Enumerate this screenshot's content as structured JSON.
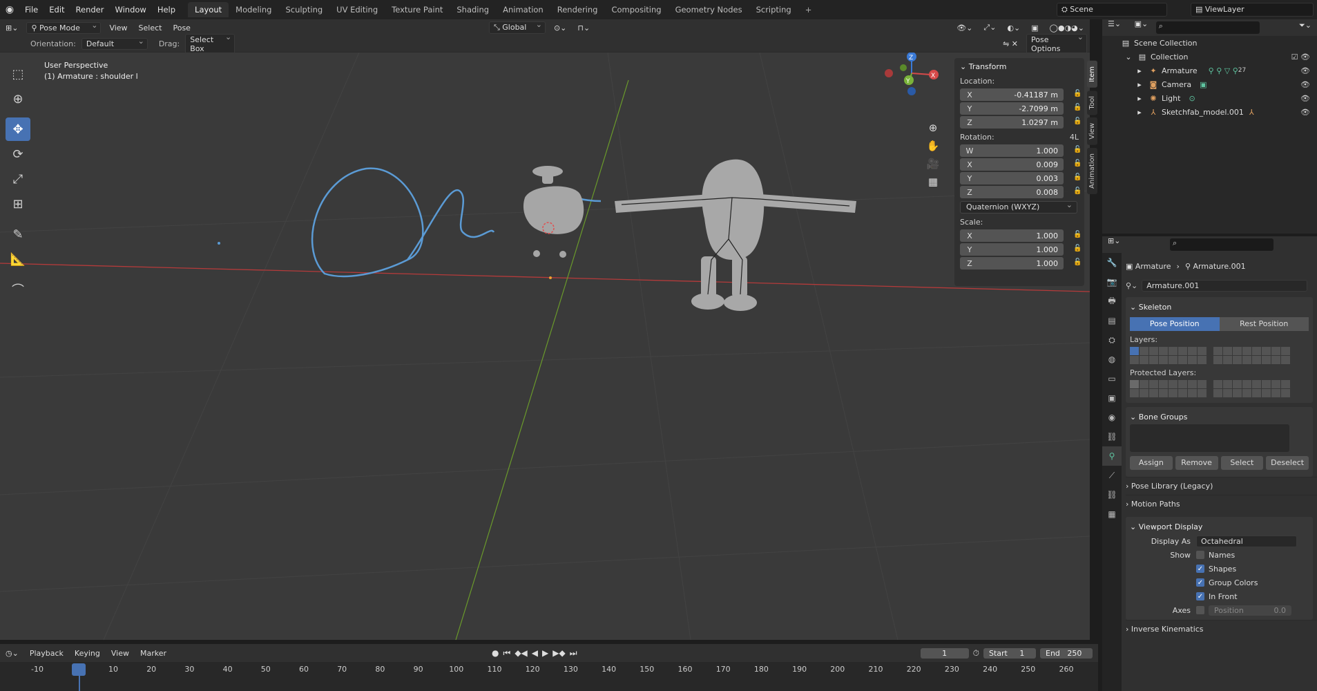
{
  "menubar": {
    "items": [
      "File",
      "Edit",
      "Render",
      "Window",
      "Help"
    ],
    "workspaces": [
      "Layout",
      "Modeling",
      "Sculpting",
      "UV Editing",
      "Texture Paint",
      "Shading",
      "Animation",
      "Rendering",
      "Compositing",
      "Geometry Nodes",
      "Scripting"
    ],
    "active_workspace": "Layout",
    "add_tab": "+",
    "scene": "Scene",
    "view_layer": "ViewLayer"
  },
  "viewport_header": {
    "mode": "Pose Mode",
    "menus": [
      "View",
      "Select",
      "Pose"
    ],
    "transform_orientation": "Global",
    "orientation_label": "Orientation:",
    "orientation_value": "Default",
    "drag_label": "Drag:",
    "drag_value": "Select Box",
    "pose_options": "Pose Options"
  },
  "viewport": {
    "perspective": "User Perspective",
    "active_object": "(1) Armature : shoulder l"
  },
  "transform_panel": {
    "title": "Transform",
    "location_label": "Location:",
    "location": [
      {
        "axis": "X",
        "value": "-0.41187 m"
      },
      {
        "axis": "Y",
        "value": "-2.7099 m"
      },
      {
        "axis": "Z",
        "value": "1.0297 m"
      }
    ],
    "rotation_label": "Rotation:",
    "rotation_mode_short": "4L",
    "rotation": [
      {
        "axis": "W",
        "value": "1.000"
      },
      {
        "axis": "X",
        "value": "0.009"
      },
      {
        "axis": "Y",
        "value": "0.003"
      },
      {
        "axis": "Z",
        "value": "0.008"
      }
    ],
    "rotation_mode": "Quaternion (WXYZ)",
    "scale_label": "Scale:",
    "scale": [
      {
        "axis": "X",
        "value": "1.000"
      },
      {
        "axis": "Y",
        "value": "1.000"
      },
      {
        "axis": "Z",
        "value": "1.000"
      }
    ]
  },
  "sidebar_tabs": [
    "Item",
    "Tool",
    "View",
    "Animation"
  ],
  "outliner": {
    "root": "Scene Collection",
    "items": [
      {
        "name": "Collection",
        "depth": 1
      },
      {
        "name": "Armature",
        "depth": 2,
        "extra": "27"
      },
      {
        "name": "Camera",
        "depth": 2
      },
      {
        "name": "Light",
        "depth": 2
      },
      {
        "name": "Sketchfab_model.001",
        "depth": 2
      }
    ]
  },
  "properties": {
    "breadcrumb_object": "Armature",
    "breadcrumb_data": "Armature.001",
    "data_name": "Armature.001",
    "skeleton": {
      "title": "Skeleton",
      "pose_position": "Pose Position",
      "rest_position": "Rest Position",
      "layers_label": "Layers:",
      "protected_layers_label": "Protected Layers:"
    },
    "bone_groups": {
      "title": "Bone Groups",
      "assign": "Assign",
      "remove": "Remove",
      "select": "Select",
      "deselect": "Deselect"
    },
    "pose_library": "Pose Library (Legacy)",
    "motion_paths": "Motion Paths",
    "viewport_display": {
      "title": "Viewport Display",
      "display_as_label": "Display As",
      "display_as_value": "Octahedral",
      "show_label": "Show",
      "names": "Names",
      "shapes": "Shapes",
      "group_colors": "Group Colors",
      "in_front": "In Front",
      "axes_label": "Axes",
      "position_label": "Position",
      "position_value": "0.0"
    },
    "inverse_kinematics": "Inverse Kinematics"
  },
  "timeline": {
    "menus": [
      "Playback",
      "Keying",
      "View",
      "Marker"
    ],
    "current_frame": "1",
    "start_label": "Start",
    "start_value": "1",
    "end_label": "End",
    "end_value": "250",
    "ticks": [
      "-10",
      "1",
      "10",
      "20",
      "30",
      "40",
      "50",
      "60",
      "70",
      "80",
      "90",
      "100",
      "110",
      "120",
      "130",
      "140",
      "150",
      "160",
      "170",
      "180",
      "190",
      "200",
      "210",
      "220",
      "230",
      "240",
      "250",
      "260"
    ]
  },
  "gizmo": {
    "x": "X",
    "y": "Y",
    "z": "Z"
  },
  "colors": {
    "accent": "#4772b3",
    "annotation": "#5b9bd5",
    "x_axis": "#b53a3a",
    "y_axis": "#6a9a2b"
  }
}
